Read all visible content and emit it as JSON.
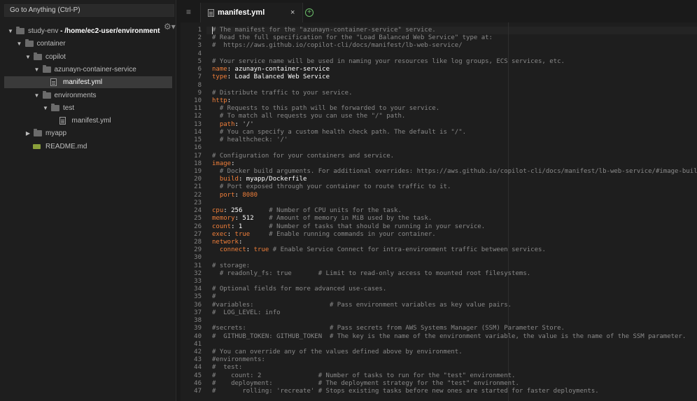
{
  "sidebar": {
    "goto_placeholder": "Go to Anything (Ctrl-P)",
    "tree": [
      {
        "type": "folder",
        "depth": 0,
        "open": true,
        "label": "study-env",
        "suffix": " - /home/ec2-user/environment"
      },
      {
        "type": "folder",
        "depth": 1,
        "open": true,
        "label": "container"
      },
      {
        "type": "folder",
        "depth": 2,
        "open": true,
        "label": "copilot"
      },
      {
        "type": "folder",
        "depth": 3,
        "open": true,
        "label": "azunayn-container-service"
      },
      {
        "type": "file",
        "depth": 4,
        "label": "manifest.yml",
        "selected": true
      },
      {
        "type": "folder",
        "depth": 3,
        "open": true,
        "label": "environments"
      },
      {
        "type": "folder",
        "depth": 4,
        "open": true,
        "label": "test"
      },
      {
        "type": "file",
        "depth": 5,
        "label": "manifest.yml"
      },
      {
        "type": "folder",
        "depth": 2,
        "open": false,
        "label": "myapp"
      },
      {
        "type": "md",
        "depth": 2,
        "label": "README.md"
      }
    ]
  },
  "editor": {
    "menu_glyph": "≡",
    "tab_label": "manifest.yml",
    "tab_close": "×",
    "new_tab_glyph": "+",
    "lines": [
      [
        [
          "c",
          "# The manifest for the \"azunayn-container-service\" service."
        ]
      ],
      [
        [
          "c",
          "# Read the full specification for the \"Load Balanced Web Service\" type at:"
        ]
      ],
      [
        [
          "c",
          "#  https://aws.github.io/copilot-cli/docs/manifest/lb-web-service/"
        ]
      ],
      [],
      [
        [
          "c",
          "# Your service name will be used in naming your resources like log groups, ECS services, etc."
        ]
      ],
      [
        [
          "k",
          "name"
        ],
        [
          "v",
          ": azunayn-container-service"
        ]
      ],
      [
        [
          "k",
          "type"
        ],
        [
          "v",
          ": Load Balanced Web Service"
        ]
      ],
      [],
      [
        [
          "c",
          "# Distribute traffic to your service."
        ]
      ],
      [
        [
          "k",
          "http"
        ],
        [
          "v",
          ":"
        ]
      ],
      [
        [
          "c",
          "  # Requests to this path will be forwarded to your service."
        ]
      ],
      [
        [
          "c",
          "  # To match all requests you can use the \"/\" path."
        ]
      ],
      [
        [
          "k",
          "  path"
        ],
        [
          "v",
          ": "
        ],
        [
          "s",
          "'/'"
        ]
      ],
      [
        [
          "c",
          "  # You can specify a custom health check path. The default is \"/\"."
        ]
      ],
      [
        [
          "c",
          "  # healthcheck: '/'"
        ]
      ],
      [],
      [
        [
          "c",
          "# Configuration for your containers and service."
        ]
      ],
      [
        [
          "k",
          "image"
        ],
        [
          "v",
          ":"
        ]
      ],
      [
        [
          "c",
          "  # Docker build arguments. For additional overrides: https://aws.github.io/copilot-cli/docs/manifest/lb-web-service/#image-build"
        ]
      ],
      [
        [
          "k",
          "  build"
        ],
        [
          "v",
          ": myapp/Dockerfile"
        ]
      ],
      [
        [
          "c",
          "  # Port exposed through your container to route traffic to it."
        ]
      ],
      [
        [
          "k",
          "  port"
        ],
        [
          "v",
          ": "
        ],
        [
          "n",
          "8080"
        ]
      ],
      [],
      [
        [
          "k",
          "cpu"
        ],
        [
          "v",
          ": 256"
        ],
        [
          "c",
          "       # Number of CPU units for the task."
        ]
      ],
      [
        [
          "k",
          "memory"
        ],
        [
          "v",
          ": 512"
        ],
        [
          "c",
          "    # Amount of memory in MiB used by the task."
        ]
      ],
      [
        [
          "k",
          "count"
        ],
        [
          "v",
          ": 1"
        ],
        [
          "c",
          "       # Number of tasks that should be running in your service."
        ]
      ],
      [
        [
          "k",
          "exec"
        ],
        [
          "v",
          ": "
        ],
        [
          "k",
          "true"
        ],
        [
          "c",
          "     # Enable running commands in your container."
        ]
      ],
      [
        [
          "k",
          "network"
        ],
        [
          "v",
          ":"
        ]
      ],
      [
        [
          "k",
          "  connect"
        ],
        [
          "v",
          ": "
        ],
        [
          "k",
          "true"
        ],
        [
          "c",
          " # Enable Service Connect for intra-environment traffic between services."
        ]
      ],
      [],
      [
        [
          "c",
          "# storage:"
        ]
      ],
      [
        [
          "c",
          "  # readonly_fs: true       # Limit to read-only access to mounted root filesystems."
        ]
      ],
      [],
      [
        [
          "c",
          "# Optional fields for more advanced use-cases."
        ]
      ],
      [
        [
          "c",
          "#"
        ]
      ],
      [
        [
          "c",
          "#variables:                    # Pass environment variables as key value pairs."
        ]
      ],
      [
        [
          "c",
          "#  LOG_LEVEL: info"
        ]
      ],
      [],
      [
        [
          "c",
          "#secrets:                      # Pass secrets from AWS Systems Manager (SSM) Parameter Store."
        ]
      ],
      [
        [
          "c",
          "#  GITHUB_TOKEN: GITHUB_TOKEN  # The key is the name of the environment variable, the value is the name of the SSM parameter."
        ]
      ],
      [],
      [
        [
          "c",
          "# You can override any of the values defined above by environment."
        ]
      ],
      [
        [
          "c",
          "#environments:"
        ]
      ],
      [
        [
          "c",
          "#  test:"
        ]
      ],
      [
        [
          "c",
          "#    count: 2               # Number of tasks to run for the \"test\" environment."
        ]
      ],
      [
        [
          "c",
          "#    deployment:            # The deployment strategy for the \"test\" environment."
        ]
      ],
      [
        [
          "c",
          "#       rolling: 'recreate' # Stops existing tasks before new ones are started for faster deployments."
        ]
      ]
    ]
  }
}
